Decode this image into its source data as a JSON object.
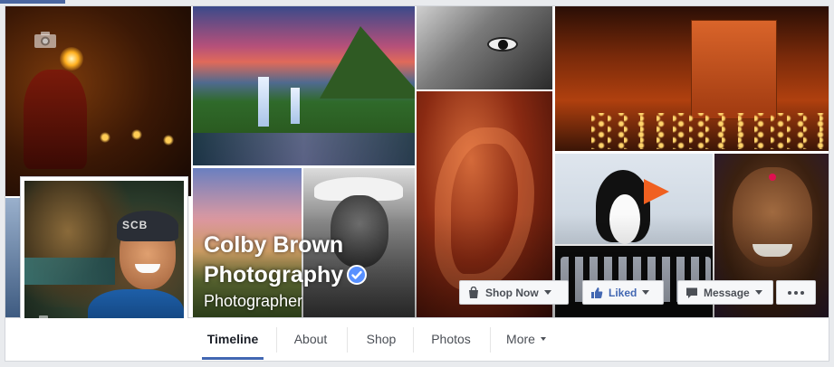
{
  "page": {
    "name_line1": "Colby Brown",
    "name_line2": "Photography",
    "category": "Photographer",
    "verified": true
  },
  "profile_picture": {
    "beanie_text": "SCB"
  },
  "actions": {
    "shop_now": "Shop Now",
    "liked": "Liked",
    "message": "Message"
  },
  "nav": {
    "tabs": [
      {
        "label": "Timeline",
        "active": true
      },
      {
        "label": "About",
        "active": false
      },
      {
        "label": "Shop",
        "active": false
      },
      {
        "label": "Photos",
        "active": false
      },
      {
        "label": "More",
        "active": false
      }
    ]
  },
  "colors": {
    "accent": "#4267b2",
    "background": "#e9ebee",
    "button_bg": "#f6f7f9",
    "text": "#4b4f56"
  },
  "icons": [
    "camera-icon",
    "verified-badge-icon",
    "shopping-bag-icon",
    "thumbs-up-icon",
    "message-bubble-icon",
    "more-dots-icon",
    "chevron-down-icon"
  ]
}
